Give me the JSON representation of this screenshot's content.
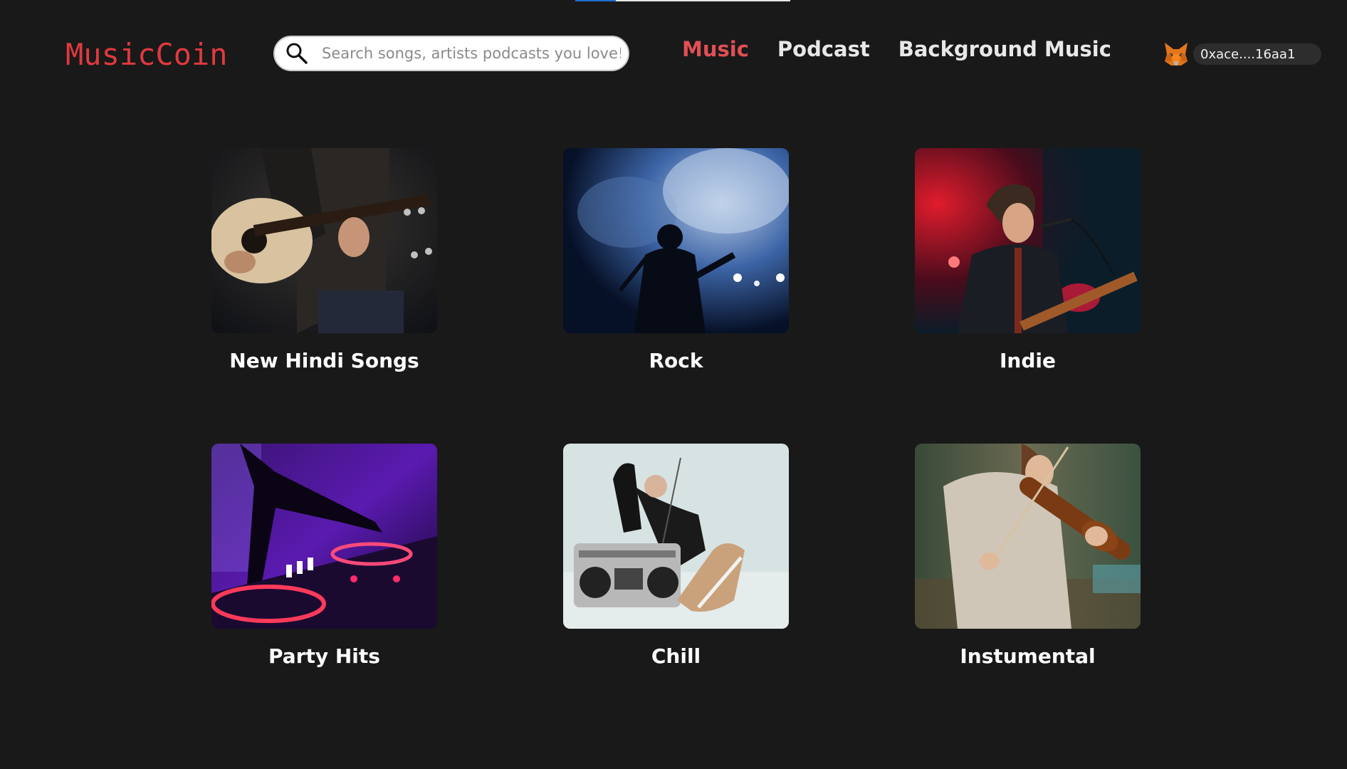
{
  "app": {
    "brand": "MusicCoin",
    "loading_progress": 0.19
  },
  "search": {
    "placeholder": "Search songs, artists podcasts you love!",
    "value": ""
  },
  "nav": {
    "items": [
      {
        "label": "Music",
        "active": true
      },
      {
        "label": "Podcast",
        "active": false
      },
      {
        "label": "Background Music",
        "active": false
      }
    ]
  },
  "wallet": {
    "address": "0xace....16aa1",
    "icon": "metamask-fox-icon"
  },
  "categories": [
    {
      "title": "New Hindi Songs",
      "image": "acoustic-guitar-player"
    },
    {
      "title": "Rock",
      "image": "silhouette-guitarist-smoke"
    },
    {
      "title": "Indie",
      "image": "singer-guitar-red-stage"
    },
    {
      "title": "Party Hits",
      "image": "dj-mixer-purple"
    },
    {
      "title": "Chill",
      "image": "person-lying-boombox"
    },
    {
      "title": "Instumental",
      "image": "violin-player"
    }
  ],
  "colors": {
    "background": "#191919",
    "brand": "#e0393e",
    "nav_active": "#e05054",
    "nav_inactive": "#e8e8e8"
  }
}
